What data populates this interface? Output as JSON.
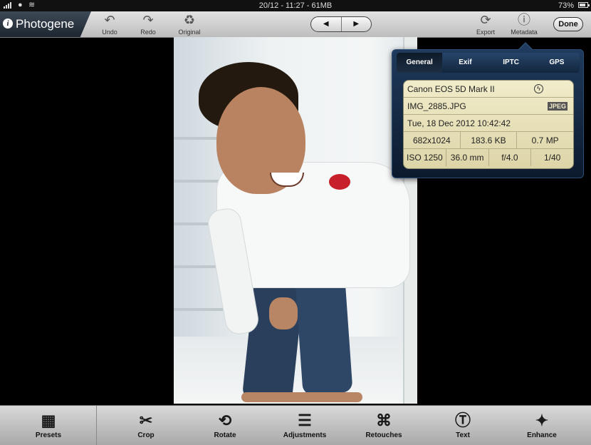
{
  "status_bar": {
    "time_memory": "20/12 - 11:27 - 61MB",
    "battery": "73%"
  },
  "toolbar": {
    "app_name": "Photogene",
    "undo_label": "Undo",
    "redo_label": "Redo",
    "original_label": "Original",
    "prev_icon": "◀",
    "next_icon": "▶",
    "export_label": "Export",
    "metadata_label": "Metadata",
    "done_label": "Done"
  },
  "metadata_popover": {
    "tabs": [
      "General",
      "Exif",
      "IPTC",
      "GPS"
    ],
    "active_tab": "General",
    "camera": "Canon EOS 5D Mark II",
    "filename": "IMG_2885.JPG",
    "format": "JPEG",
    "date": "Tue, 18 Dec 2012 10:42:42",
    "dimensions": "682x1024",
    "file_size": "183.6 KB",
    "megapixels": "0.7 MP",
    "iso": "ISO 1250",
    "focal_length": "36.0 mm",
    "aperture": "f/4.0",
    "shutter": "1/40"
  },
  "bottom_toolbar": {
    "items": [
      {
        "label": "Presets",
        "icon": "presets-icon"
      },
      {
        "label": "Crop",
        "icon": "scissors-icon"
      },
      {
        "label": "Rotate",
        "icon": "rotate-icon"
      },
      {
        "label": "Adjustments",
        "icon": "sliders-icon"
      },
      {
        "label": "Retouches",
        "icon": "bandage-icon"
      },
      {
        "label": "Text",
        "icon": "text-bubble-icon"
      },
      {
        "label": "Enhance",
        "icon": "enhance-icon"
      }
    ]
  }
}
